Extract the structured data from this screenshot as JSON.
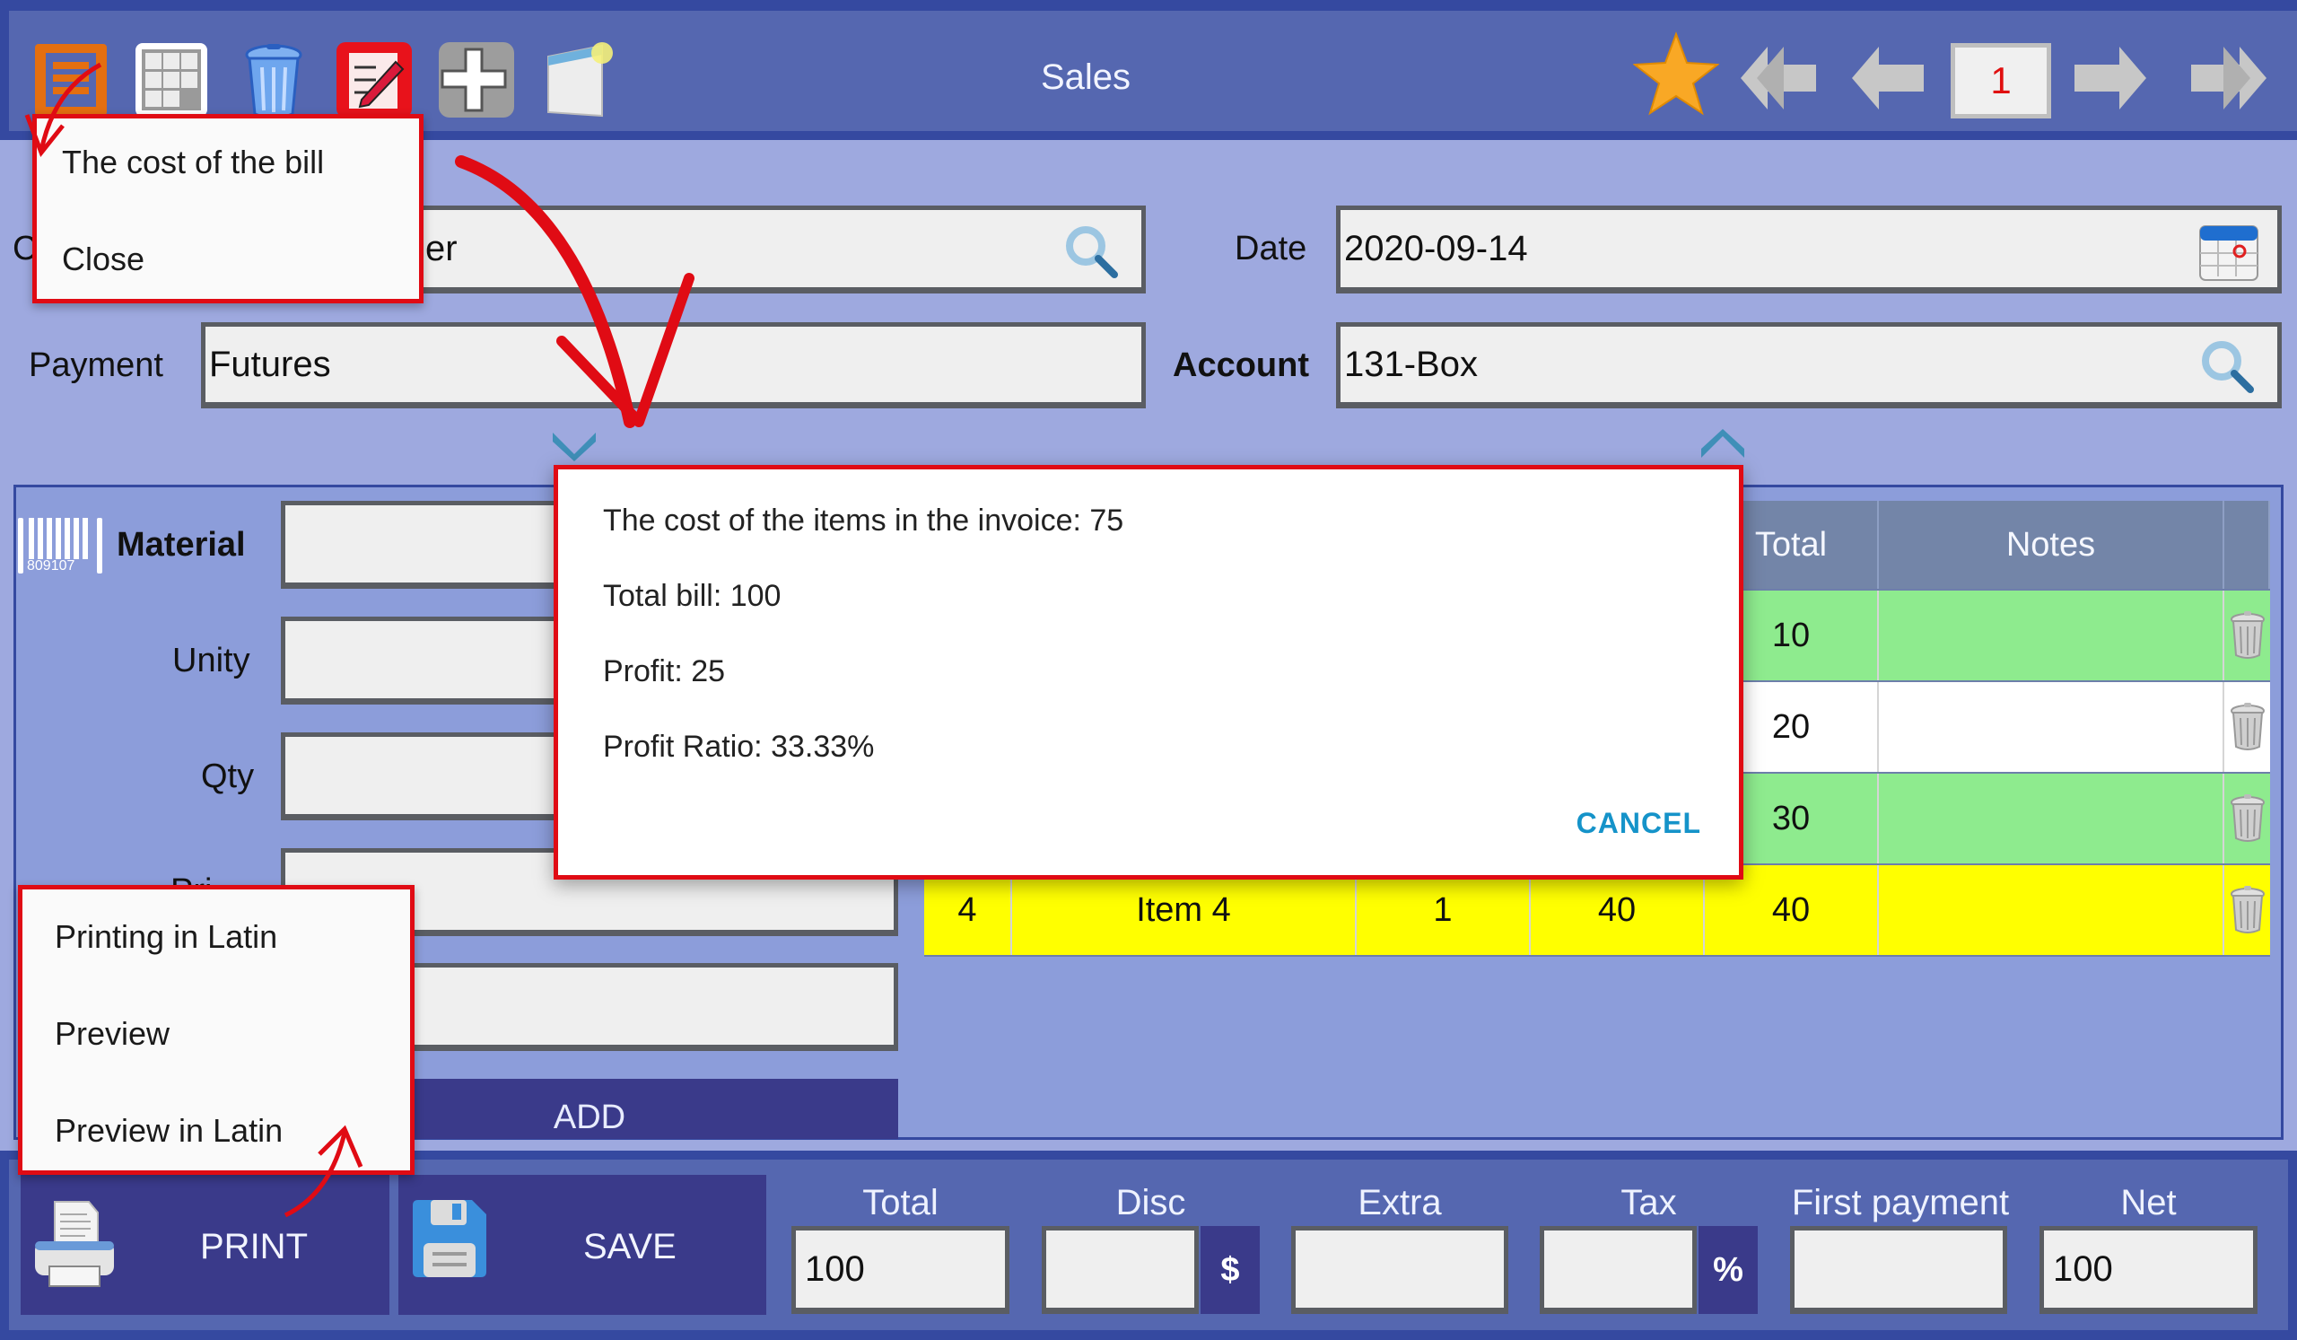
{
  "header": {
    "title": "Sales",
    "page_number": "1",
    "toolbar_icons": [
      "menu-icon",
      "grid-icon",
      "trash-icon",
      "edit-icon",
      "add-icon",
      "window-icon"
    ],
    "nav_icons": [
      "star-icon",
      "first-page-icon",
      "previous-page-icon",
      "next-page-icon",
      "last-page-icon"
    ]
  },
  "menu_popup": {
    "items": [
      "The cost of the bill",
      "Close"
    ]
  },
  "form": {
    "customer": {
      "label": "C",
      "value_visible": "er"
    },
    "date": {
      "label": "Date",
      "value": "2020-09-14"
    },
    "payment": {
      "label": "Payment",
      "value": "Futures"
    },
    "account": {
      "label": "Account",
      "value": "131-Box"
    }
  },
  "item_entry": {
    "barcode_text": "809107",
    "material_label": "Material",
    "unity_label": "Unity",
    "qty_label": "Qty",
    "price_label": "Pri",
    "material_value": "",
    "unity_value": "",
    "qty_value": "",
    "price_value": "",
    "extra_value": "",
    "add_label": "ADD"
  },
  "table": {
    "headers": [
      "",
      "",
      "",
      "",
      "Total",
      "Notes",
      ""
    ],
    "rows": [
      {
        "no": "",
        "item": "",
        "qty": "",
        "price": "",
        "total": "10",
        "notes": "",
        "color": "#8eeb8e"
      },
      {
        "no": "",
        "item": "",
        "qty": "",
        "price": "",
        "total": "20",
        "notes": "",
        "color": "#ffffff"
      },
      {
        "no": "",
        "item": "",
        "qty": "",
        "price": "",
        "total": "30",
        "notes": "",
        "color": "#8eeb8e"
      },
      {
        "no": "4",
        "item": "Item 4",
        "qty": "1",
        "price": "40",
        "total": "40",
        "notes": "",
        "color": "#ffff00"
      }
    ]
  },
  "dialog": {
    "lines": [
      "The cost of the items in the invoice: 75",
      "Total bill: 100",
      "Profit: 25",
      "Profit Ratio: 33.33%"
    ],
    "cancel_label": "CANCEL"
  },
  "print_popup": {
    "items": [
      "Printing in Latin",
      "Preview",
      "Preview in Latin"
    ]
  },
  "bottom": {
    "print_label": "PRINT",
    "save_label": "SAVE",
    "totals": {
      "total_label": "Total",
      "total_value": "100",
      "disc_label": "Disc",
      "disc_value": "",
      "disc_unit": "$",
      "extra_label": "Extra",
      "extra_value": "",
      "tax_label": "Tax",
      "tax_value": "",
      "tax_unit": "%",
      "first_payment_label": "First payment",
      "first_payment_value": "",
      "net_label": "Net",
      "net_value": "100"
    }
  },
  "colors": {
    "accent_red": "#e00b14",
    "header_blue": "#5567b0",
    "cancel_blue": "#1593c9"
  }
}
